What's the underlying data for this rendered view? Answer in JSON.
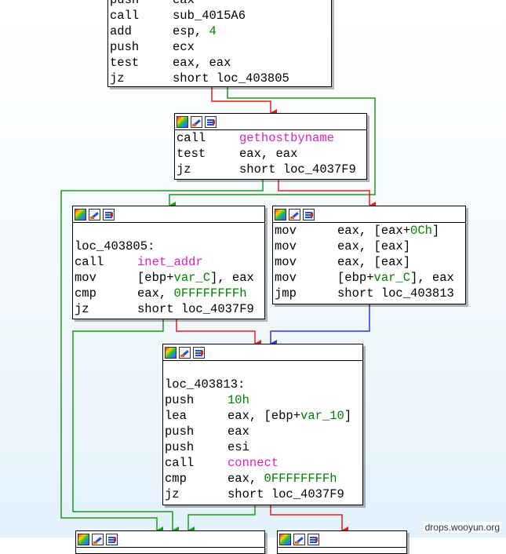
{
  "watermark": "drops.wooyun.org",
  "colors": {
    "true_edge": "#1a9c1a",
    "false_edge": "#e02020",
    "uncond_edge": "#1f3ed8",
    "number": "#008000",
    "function": "#e020c0"
  },
  "icons": [
    "color-palette-icon",
    "edit-pencil-icon",
    "graph-overview-icon"
  ],
  "blocks": {
    "b0": {
      "lines": [
        {
          "op": "push",
          "args": [
            {
              "t": "eax"
            }
          ]
        },
        {
          "op": "call",
          "args": [
            {
              "t": "sub_4015A6"
            }
          ]
        },
        {
          "op": "add",
          "args": [
            {
              "t": "esp, "
            },
            {
              "t": "4",
              "c": "num"
            }
          ]
        },
        {
          "op": "push",
          "args": [
            {
              "t": "ecx"
            }
          ]
        },
        {
          "op": "test",
          "args": [
            {
              "t": "eax, eax"
            }
          ]
        },
        {
          "op": "jz",
          "args": [
            {
              "t": "short loc_403805"
            }
          ]
        }
      ]
    },
    "b1": {
      "lines": [
        {
          "op": "call",
          "args": [
            {
              "t": "gethostbyname",
              "c": "fn"
            }
          ]
        },
        {
          "op": "test",
          "args": [
            {
              "t": "eax, eax"
            }
          ]
        },
        {
          "op": "jz",
          "args": [
            {
              "t": "short loc_4037F9"
            }
          ]
        }
      ]
    },
    "b2": {
      "label": "loc_403805:",
      "lines": [
        {
          "op": "call",
          "args": [
            {
              "t": "inet_addr",
              "c": "fn"
            }
          ]
        },
        {
          "op": "mov",
          "args": [
            {
              "t": "[ebp+"
            },
            {
              "t": "var_C",
              "c": "var"
            },
            {
              "t": "], eax"
            }
          ]
        },
        {
          "op": "cmp",
          "args": [
            {
              "t": "eax, "
            },
            {
              "t": "0FFFFFFFFh",
              "c": "num"
            }
          ]
        },
        {
          "op": "jz",
          "args": [
            {
              "t": "short loc_4037F9"
            }
          ]
        }
      ]
    },
    "b3": {
      "lines": [
        {
          "op": "mov",
          "args": [
            {
              "t": "eax, [eax+"
            },
            {
              "t": "0Ch",
              "c": "num"
            },
            {
              "t": "]"
            }
          ]
        },
        {
          "op": "mov",
          "args": [
            {
              "t": "eax, [eax]"
            }
          ]
        },
        {
          "op": "mov",
          "args": [
            {
              "t": "eax, [eax]"
            }
          ]
        },
        {
          "op": "mov",
          "args": [
            {
              "t": "[ebp+"
            },
            {
              "t": "var_C",
              "c": "var"
            },
            {
              "t": "], eax"
            }
          ]
        },
        {
          "op": "jmp",
          "args": [
            {
              "t": "short loc_403813"
            }
          ]
        }
      ]
    },
    "b4": {
      "label": "loc_403813:",
      "lines": [
        {
          "op": "push",
          "args": [
            {
              "t": "10h",
              "c": "num"
            }
          ]
        },
        {
          "op": "lea",
          "args": [
            {
              "t": "eax, [ebp+"
            },
            {
              "t": "var_10",
              "c": "var"
            },
            {
              "t": "]"
            }
          ]
        },
        {
          "op": "push",
          "args": [
            {
              "t": "eax"
            }
          ]
        },
        {
          "op": "push",
          "args": [
            {
              "t": "esi"
            }
          ]
        },
        {
          "op": "call",
          "args": [
            {
              "t": "connect",
              "c": "fn"
            }
          ]
        },
        {
          "op": "cmp",
          "args": [
            {
              "t": "eax, "
            },
            {
              "t": "0FFFFFFFFh",
              "c": "num"
            }
          ]
        },
        {
          "op": "jz",
          "args": [
            {
              "t": "short loc_4037F9"
            }
          ]
        }
      ]
    },
    "b5": {
      "lines": []
    },
    "b6": {
      "lines": []
    }
  }
}
